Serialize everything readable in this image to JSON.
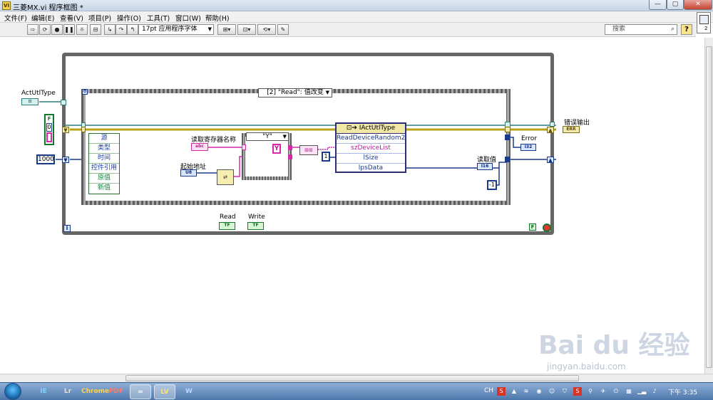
{
  "window": {
    "title": "三菱MX.vi 程序框图 *",
    "app_icon": "VI"
  },
  "menu": [
    "文件(F)",
    "编辑(E)",
    "查看(V)",
    "项目(P)",
    "操作(O)",
    "工具(T)",
    "窗口(W)",
    "帮助(H)"
  ],
  "toolbar": {
    "font": "17pt 应用程序字体",
    "search_placeholder": "搜索",
    "help": "?"
  },
  "vi_corner": {
    "terminal_count": "2"
  },
  "diagram": {
    "actutltype_label": "ActUtlType",
    "bool_const": "F",
    "numeric_const": "0",
    "wait_const": "1000",
    "case_selector": "[2] \"Read\": 值改变",
    "event_data": [
      "源",
      "类型",
      "时间",
      "控件引用",
      "原值",
      "新值"
    ],
    "register_label": "读取寄存器名称",
    "register_term": "abc",
    "start_addr_label": "起始地址",
    "start_addr_term": "U8",
    "inner_selector": "\"Y\"",
    "y_const": "Y",
    "size_const": "1",
    "invoke_node": {
      "class": "IActUtlType",
      "method": "ReadDeviceRandom2",
      "params": [
        "szDeviceList",
        "lSize",
        "lpsData"
      ]
    },
    "error_label": "Error",
    "error_term": "I32",
    "read_value_label": "读取值",
    "read_value_term": "I16",
    "neg_one_const": "-1",
    "error_out_label": "错误输出",
    "error_out_term": "ERR",
    "read_button_label": "Read",
    "write_button_label": "Write",
    "tf_term": "TF",
    "loop_index": "i",
    "stop_const": "F"
  },
  "taskbar": {
    "apps": [
      "IE",
      "Lr",
      "Chrome",
      "PDF",
      "∞",
      "LV",
      "W"
    ],
    "input_method": "CH",
    "clock": "下午 3:35"
  },
  "watermark": {
    "main": "Bai du 经验",
    "sub": "jingyan.baidu.com"
  }
}
